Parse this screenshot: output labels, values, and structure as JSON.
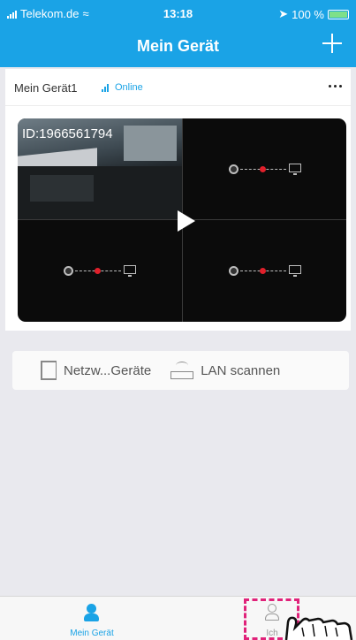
{
  "status_bar": {
    "carrier": "Telekom.de",
    "time": "13:18",
    "battery": "100 %"
  },
  "header": {
    "title": "Mein Gerät"
  },
  "device": {
    "name": "Mein Gerät1",
    "status": "Online",
    "camera_id": "ID:1966561794"
  },
  "actions": [
    {
      "label": "Netzw...Geräte",
      "icon": "tablet-icon"
    },
    {
      "label": "LAN scannen",
      "icon": "router-icon"
    }
  ],
  "tabs": [
    {
      "label": "Mein Gerät",
      "icon": "user-icon",
      "active": true
    },
    {
      "label": "Ich",
      "icon": "user-outline-icon",
      "active": false
    }
  ],
  "colors": {
    "accent": "#1aa3e6",
    "highlight": "#e0227a",
    "record_dot": "#e0202b"
  }
}
